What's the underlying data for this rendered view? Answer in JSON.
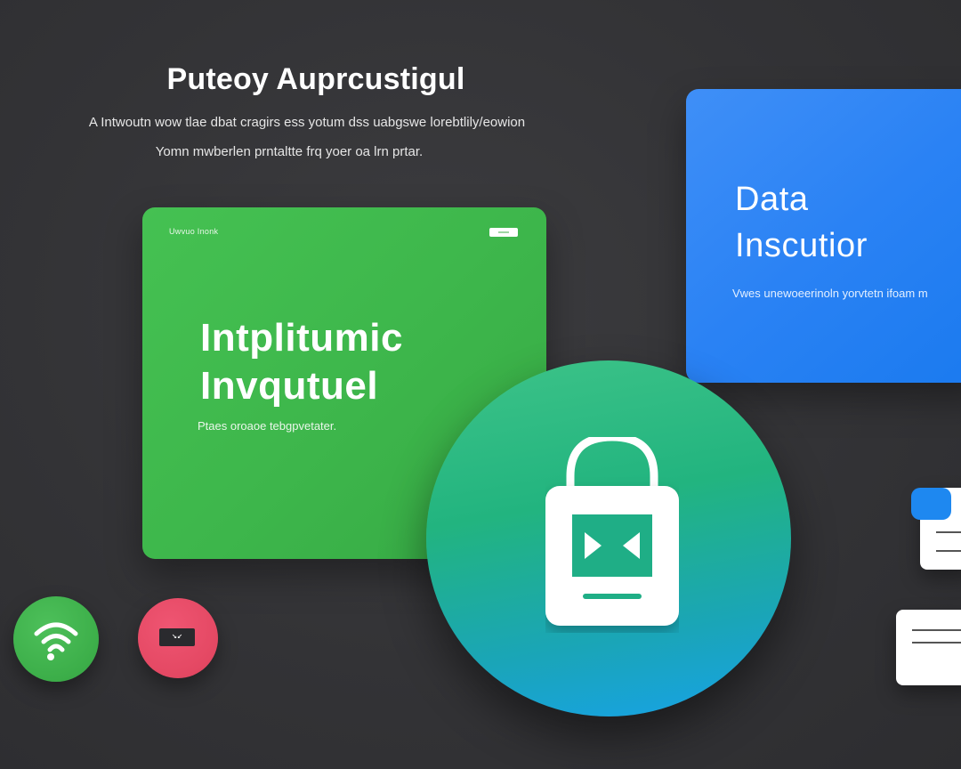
{
  "hero": {
    "title": "Puteoy Auprcustigul",
    "subtitle_line1": "A Intwoutn wow tlae dbat cragirs ess yotum dss uabgswe lorebtlily/eowion",
    "subtitle_line2": "Yomn mwberlen prntaltte frq yoer oa lrn prtar."
  },
  "green_card": {
    "eyebrow": "Uwvuo Inonk",
    "title_line1": "Intplitumic",
    "title_line2": "Invqutuel",
    "caption": "Ptaes oroaoe tebgpvetater.",
    "color": "#3db64b"
  },
  "blue_card": {
    "title_line1": "Data",
    "title_line2": "Inscutior",
    "caption": "Vwes unewoeerinoln yorvtetn ifoam m",
    "color": "#2a82f4"
  },
  "lock_circle": {
    "icon": "lock-icon",
    "colors": [
      "#3dc388",
      "#17a2e8"
    ]
  },
  "wifi_button": {
    "icon": "wifi-icon",
    "color": "#3cae49"
  },
  "red_button": {
    "icon": "screen-icon",
    "screen_text": "↘↙",
    "color": "#e44863"
  },
  "doc_cards": {
    "icon": "document-icon",
    "accent": "#1e88f0"
  }
}
